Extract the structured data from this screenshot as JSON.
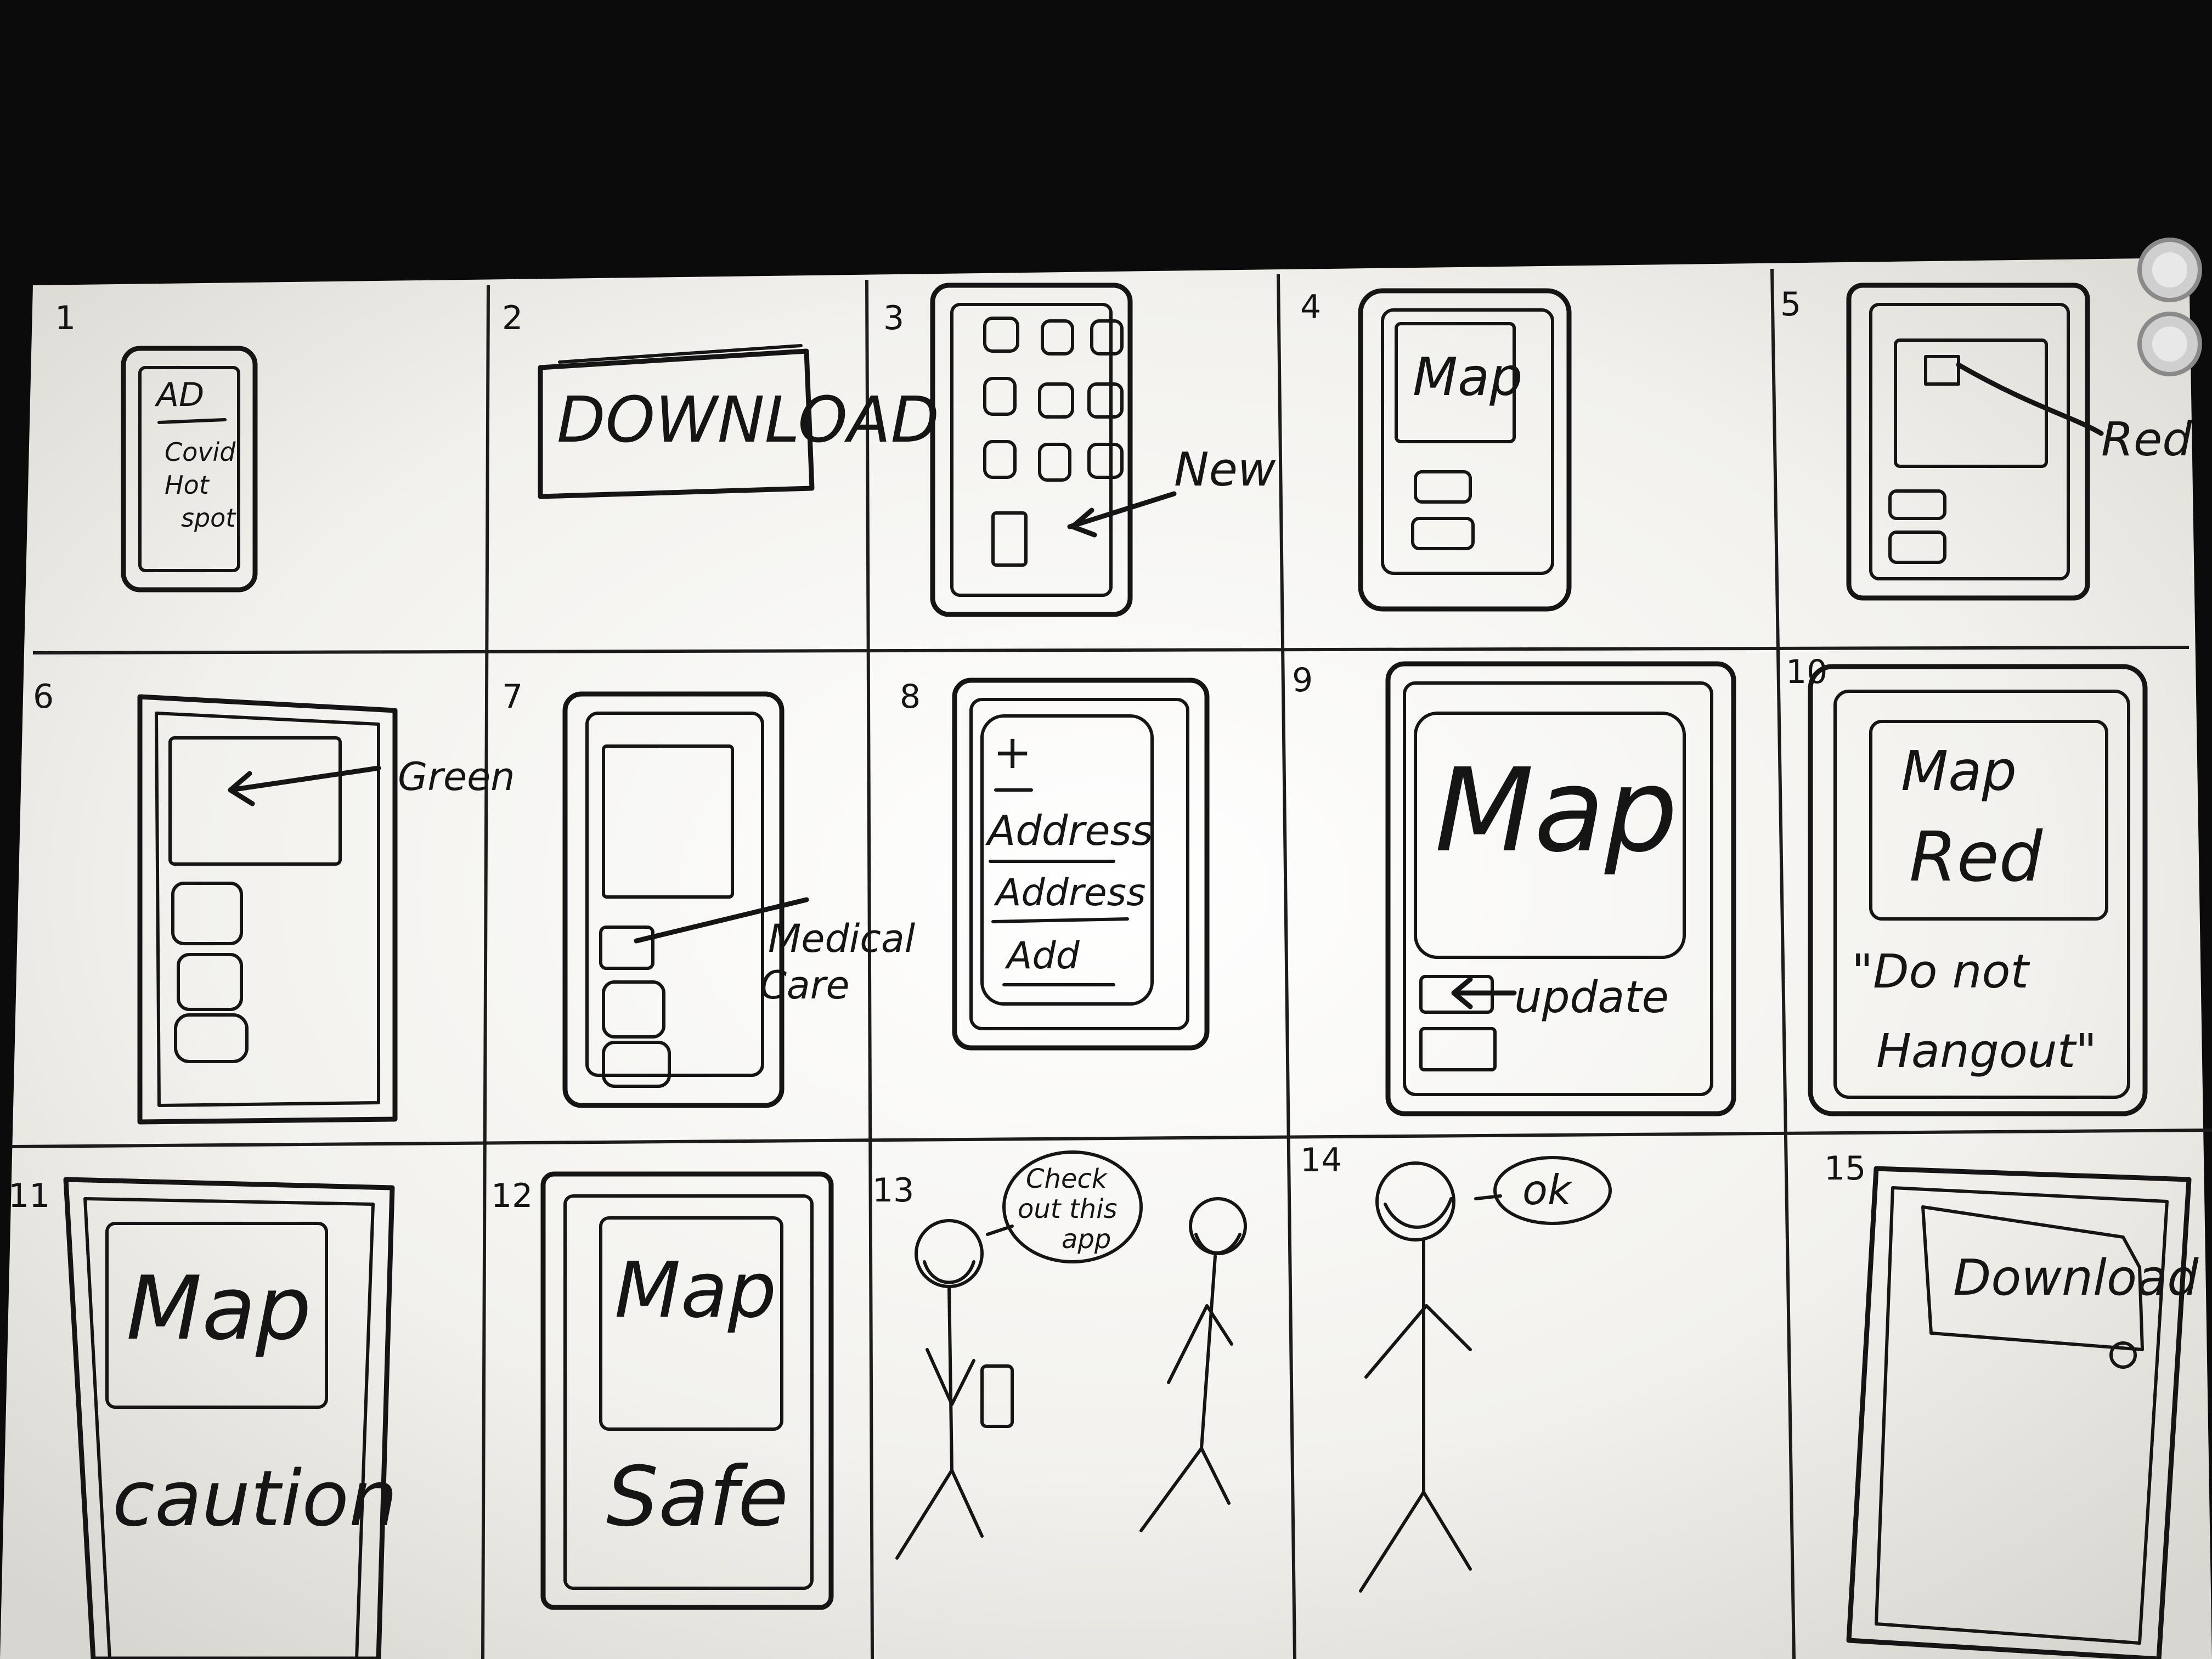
{
  "panels": [
    {
      "number": "1",
      "lines": [
        "AD",
        "Covid",
        "Hot",
        "spot"
      ]
    },
    {
      "number": "2",
      "lines": [
        "DOWNLOAD"
      ]
    },
    {
      "number": "3",
      "callout": "New"
    },
    {
      "number": "4",
      "lines": [
        "Map"
      ]
    },
    {
      "number": "5",
      "callout": "Red"
    },
    {
      "number": "6",
      "callout": "Green"
    },
    {
      "number": "7",
      "callout": [
        "Medical",
        "Care"
      ]
    },
    {
      "number": "8",
      "lines": [
        "+",
        "Address",
        "Address",
        "Add"
      ]
    },
    {
      "number": "9",
      "lines": [
        "Map"
      ],
      "callout": "update"
    },
    {
      "number": "10",
      "lines": [
        "Map",
        "Red"
      ],
      "quote": [
        "\"Do not",
        "Hangout\""
      ]
    },
    {
      "number": "11",
      "lines": [
        "Map",
        "caution"
      ]
    },
    {
      "number": "12",
      "lines": [
        "Map",
        "Safe"
      ]
    },
    {
      "number": "13",
      "speech": [
        "Check",
        "out this",
        "app"
      ]
    },
    {
      "number": "14",
      "speech": [
        "ok"
      ]
    },
    {
      "number": "15",
      "lines": [
        "Download"
      ]
    }
  ],
  "colors": {
    "background": "#0b0b0b",
    "board": "#f1f0ec",
    "ink": "#151515"
  }
}
